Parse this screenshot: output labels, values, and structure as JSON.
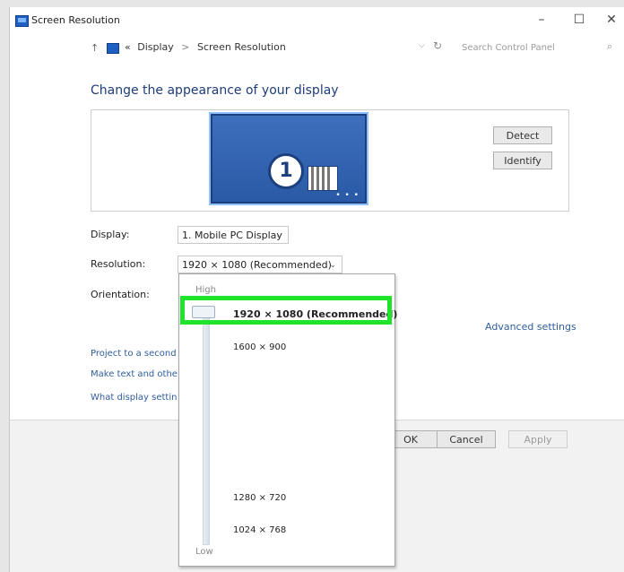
{
  "window": {
    "title": "Screen Resolution"
  },
  "controls": {
    "minimize": "–",
    "maximize": "☐",
    "close": "✕"
  },
  "address": {
    "up": "↑",
    "overflow": "«",
    "crumbs": [
      "Display",
      "Screen Resolution"
    ],
    "separator": ">",
    "dropdown": "⌵",
    "refresh": "↻"
  },
  "search": {
    "placeholder": "Search Control Panel",
    "icon": "⌕"
  },
  "heading": "Change the appearance of your display",
  "monitor": {
    "number": "1",
    "dots": "• • •"
  },
  "buttons": {
    "detect": "Detect",
    "identify": "Identify",
    "ok": "OK",
    "cancel": "Cancel",
    "apply": "Apply"
  },
  "fields": {
    "display_label": "Display:",
    "display_value": "1. Mobile PC Display",
    "resolution_label": "Resolution:",
    "resolution_value": "1920 × 1080 (Recommended)",
    "orientation_label": "Orientation:",
    "chevron": "⌄"
  },
  "advanced_settings": "Advanced settings",
  "links": [
    "Project to a second",
    "Make text and othe",
    "What display settin"
  ],
  "partial_text": ")",
  "dropdown": {
    "high_label": "High",
    "low_label": "Low",
    "options": [
      "1920 × 1080 (Recommended)",
      "1600 × 900",
      "1280 × 720",
      "1024 × 768"
    ]
  },
  "colors": {
    "highlight": "#22e32b",
    "heading": "#1e3c78",
    "link": "#2f5d9b",
    "monitor": "#2a5aa6"
  }
}
